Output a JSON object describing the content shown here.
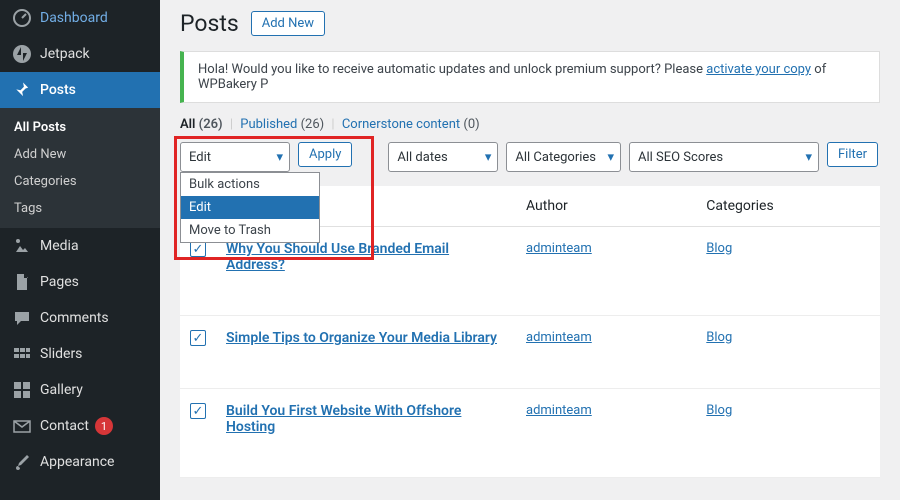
{
  "sidebar": {
    "dashboard": "Dashboard",
    "jetpack": "Jetpack",
    "posts": "Posts",
    "media": "Media",
    "pages": "Pages",
    "comments": "Comments",
    "sliders": "Sliders",
    "gallery": "Gallery",
    "contact": "Contact",
    "contact_badge": "1",
    "appearance": "Appearance",
    "submenu": {
      "all_posts": "All Posts",
      "add_new": "Add New",
      "categories": "Categories",
      "tags": "Tags"
    }
  },
  "header": {
    "title": "Posts",
    "add_new": "Add New"
  },
  "notice": {
    "prefix": "Hola! Would you like to receive automatic updates and unlock premium support? Please ",
    "link": "activate your copy",
    "suffix": " of WPBakery P"
  },
  "subsub": {
    "all": "All",
    "all_count": "(26)",
    "published": "Published",
    "published_count": "(26)",
    "cornerstone": "Cornerstone content",
    "cornerstone_count": "(0)"
  },
  "filters": {
    "bulk_selected": "Edit",
    "bulk_options": [
      "Bulk actions",
      "Edit",
      "Move to Trash"
    ],
    "apply": "Apply",
    "dates": "All dates",
    "categories": "All Categories",
    "seo": "All SEO Scores",
    "filter": "Filter"
  },
  "table": {
    "head_author": "Author",
    "head_categories": "Categories",
    "rows": [
      {
        "title": "Why You Should Use Branded Email Address?",
        "author": "adminteam",
        "category": "Blog"
      },
      {
        "title": "Simple Tips to Organize Your Media Library",
        "author": "adminteam",
        "category": "Blog"
      },
      {
        "title": "Build You First Website With Offshore Hosting",
        "author": "adminteam",
        "category": "Blog"
      }
    ]
  }
}
